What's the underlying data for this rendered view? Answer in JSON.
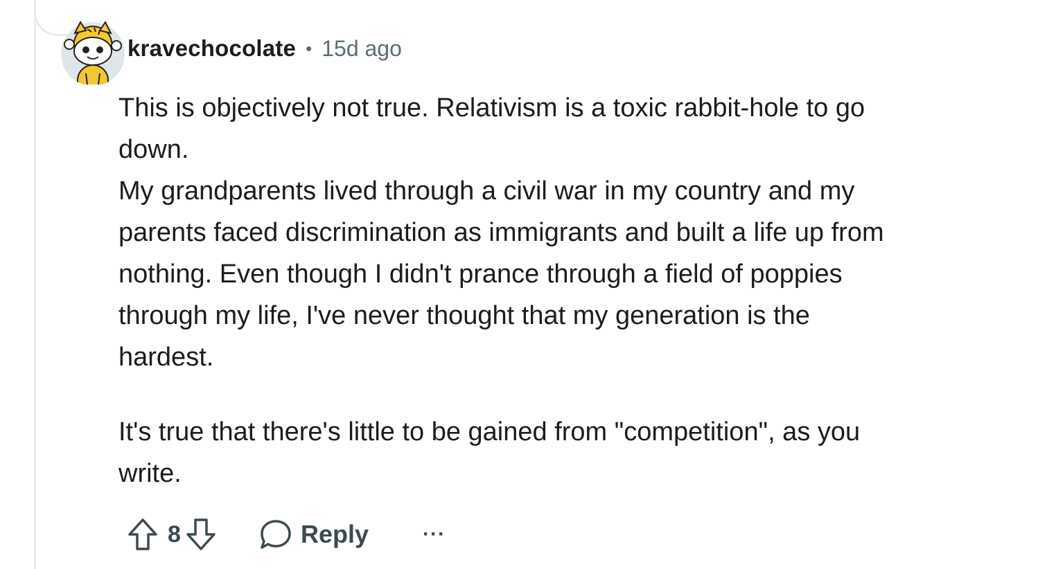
{
  "comment": {
    "username": "kravechocolate",
    "separator": "•",
    "timestamp": "15d ago",
    "avatar_icon": "snoo-avatar-yellow-cat-hat",
    "paragraphs": [
      "This is objectively not true. Relativism is a toxic rabbit-hole to go",
      "down.",
      "My grandparents lived through a civil war in my country and my",
      "parents faced discrimination as immigrants and built a life up from",
      "nothing. Even though I didn't prance through a field of poppies",
      "through my life, I've never thought that my generation is the",
      "hardest."
    ],
    "paragraphs2": [
      "It's true that there's little to be gained from \"competition\", as you",
      "write."
    ],
    "actions": {
      "upvote_icon": "upvote-arrow-icon",
      "score": "8",
      "downvote_icon": "downvote-arrow-icon",
      "reply_icon": "speech-bubble-icon",
      "reply_label": "Reply",
      "more_label": "···"
    }
  },
  "colors": {
    "text": "#1c1c1c",
    "meta": "#5c6c74",
    "action": "#3c4a50",
    "thread_line": "#e5ebee",
    "avatar_bg": "#dfe6ea",
    "avatar_accent": "#f5c832"
  }
}
